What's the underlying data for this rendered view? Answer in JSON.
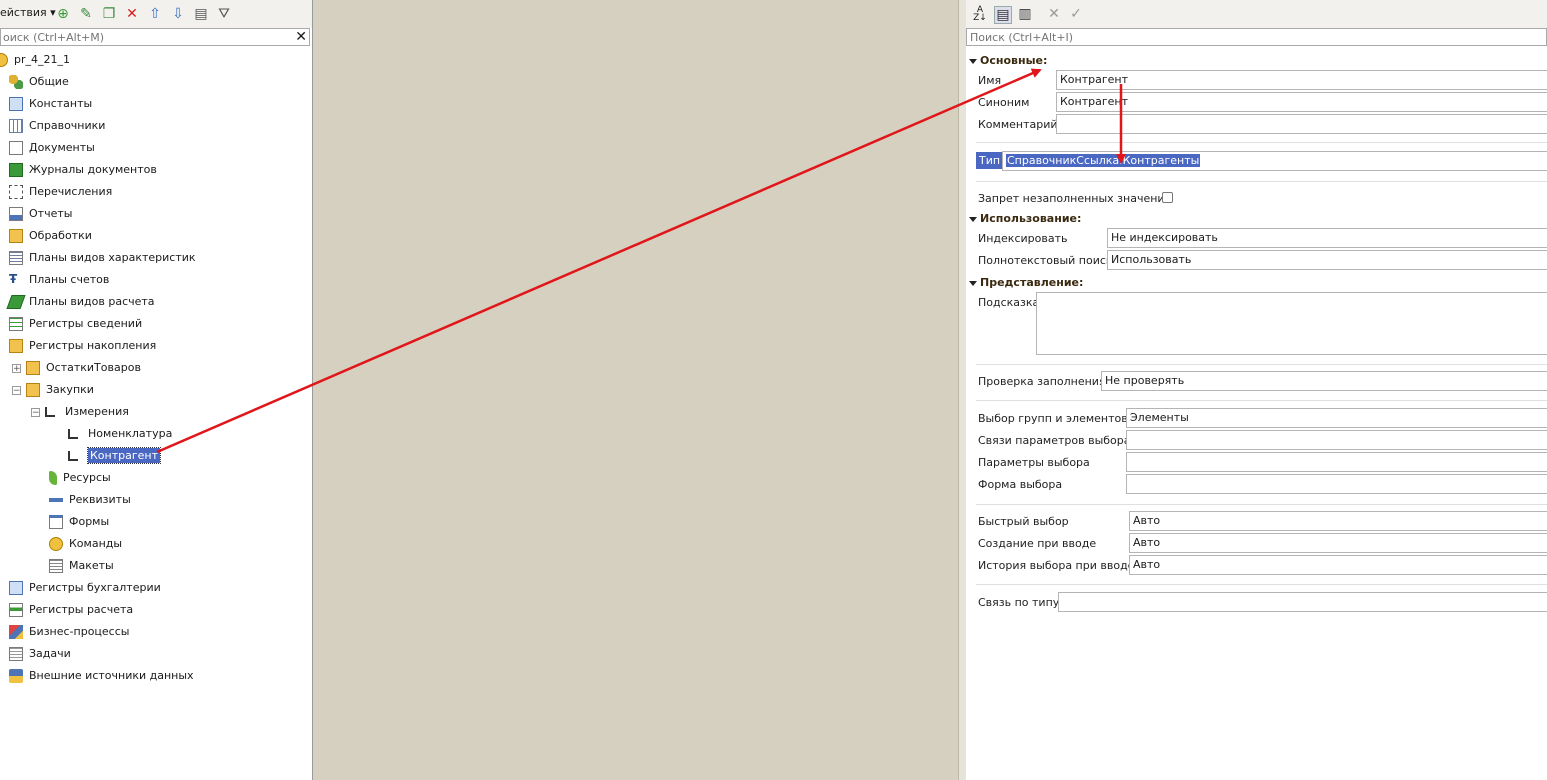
{
  "left_panel": {
    "toolbar": {
      "actions_label": "ействия"
    },
    "search_placeholder": "оиск (Ctrl+Alt+M)",
    "tree": {
      "root": "pr_4_21_1",
      "items": [
        "Общие",
        "Константы",
        "Справочники",
        "Документы",
        "Журналы документов",
        "Перечисления",
        "Отчеты",
        "Обработки",
        "Планы видов характеристик",
        "Планы счетов",
        "Планы видов расчета",
        "Регистры сведений",
        "Регистры накопления"
      ],
      "accum": {
        "ostatki": "ОстаткиТоваров",
        "zakupki": "Закупки"
      },
      "zakupki_children": {
        "izmereniya": "Измерения",
        "nomenklatura": "Номенклатура",
        "kontragent": "Контрагент",
        "resursy": "Ресурсы",
        "rekvizity": "Реквизиты",
        "formy": "Формы",
        "komandy": "Команды",
        "makety": "Макеты"
      },
      "tail_items": [
        "Регистры бухгалтерии",
        "Регистры расчета",
        "Бизнес-процессы",
        "Задачи",
        "Внешние источники данных"
      ]
    }
  },
  "right_panel": {
    "search_placeholder": "Поиск (Ctrl+Alt+I)",
    "sections": {
      "main": "Основные:",
      "usage": "Использование:",
      "presentation": "Представление:"
    },
    "fields": {
      "name_label": "Имя",
      "name_value": "Контрагент",
      "synonym_label": "Синоним",
      "synonym_value": "Контрагент",
      "comment_label": "Комментарий",
      "comment_value": "",
      "type_label": "Тип",
      "type_value": "СправочникСсылка.Контрагенты",
      "deny_empty_label": "Запрет незаполненных значений",
      "index_label": "Индексировать",
      "index_value": "Не индексировать",
      "fulltext_label": "Полнотекстовый поиск",
      "fulltext_value": "Использовать",
      "tooltip_label": "Подсказка",
      "fill_check_label": "Проверка заполнения",
      "fill_check_value": "Не проверять",
      "choose_groups_label": "Выбор групп и элементов",
      "choose_groups_value": "Элементы",
      "choice_params_links_label": "Связи параметров выбора",
      "choice_params_label": "Параметры выбора",
      "choice_form_label": "Форма выбора",
      "quick_choice_label": "Быстрый выбор",
      "quick_choice_value": "Авто",
      "create_on_input_label": "Создание при вводе",
      "create_on_input_value": "Авто",
      "history_label": "История выбора при вводе",
      "history_value": "Авто",
      "link_by_type_label": "Связь по типу"
    }
  },
  "colors": {
    "annotation_arrow": "#e0161a",
    "selection": "#4a68c2"
  }
}
